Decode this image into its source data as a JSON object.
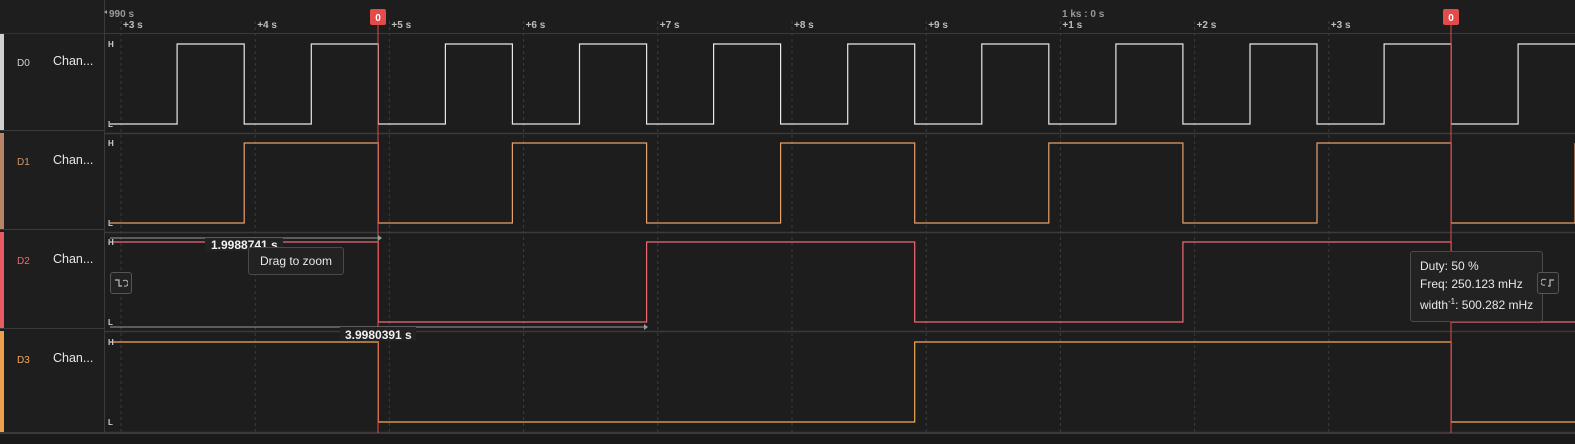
{
  "colors": {
    "background": "#1d1d1d",
    "grid": "#3b3b3b",
    "cursor": "#e34a4a",
    "d0": "#e8e8e8",
    "d1": "#e6a16e",
    "d2": "#f06a72",
    "d3": "#f3aa57"
  },
  "ruler": {
    "origin_label": "990 s",
    "center_label": "1 ks : 0 s",
    "ticks": [
      "+3 s",
      "+4 s",
      "+5 s",
      "+6 s",
      "+7 s",
      "+8 s",
      "+9 s",
      "+1 s",
      "+2 s",
      "+3 s"
    ],
    "cursor_badges": [
      "0",
      "0"
    ]
  },
  "channels": [
    {
      "id": "D0",
      "name": "Chan...",
      "color": "#e8e8e8",
      "edges": [
        0.4999,
        0.9998,
        1.4998,
        1.9989,
        2.4994,
        2.9986,
        3.4984,
        3.9983,
        4.4977,
        4.9973,
        5.4968,
        5.9965,
        6.4962,
        6.9958,
        7.4956,
        7.9948,
        8.4945,
        8.9942,
        9.4938,
        9.9933,
        10.4928
      ],
      "start": "low"
    },
    {
      "id": "D1",
      "name": "Chan...",
      "color": "#e6a16e",
      "edges": [
        0.9998,
        1.9989,
        2.9986,
        3.9983,
        4.9973,
        5.9965,
        6.9958,
        7.9948,
        8.9942,
        9.9933,
        10.9923
      ],
      "start": "low"
    },
    {
      "id": "D2",
      "name": "Chan...",
      "color": "#f06a72",
      "edges": [
        1.9989,
        3.9983,
        5.9965,
        7.9948,
        9.9933
      ],
      "start": "high"
    },
    {
      "id": "D3",
      "name": "Chan...",
      "color": "#f3aa57",
      "edges": [
        1.9989,
        5.9965,
        9.9933
      ],
      "start": "high"
    }
  ],
  "level_labels": {
    "high": "H",
    "low": "L"
  },
  "measurements": {
    "top_width": "1.9988741 s",
    "bottom_width": "3.9980391 s"
  },
  "tooltip_drag": "Drag to zoom",
  "tooltip_measure": {
    "duty": "Duty: 50 %",
    "freq": "Freq: 250.123 mHz",
    "width_prefix": "width",
    "width_sup": "-1",
    "width_value": ": 500.282 mHz"
  },
  "icons": {
    "falling_edge": "falling-edge-icon",
    "rising_edge": "rising-edge-icon"
  }
}
